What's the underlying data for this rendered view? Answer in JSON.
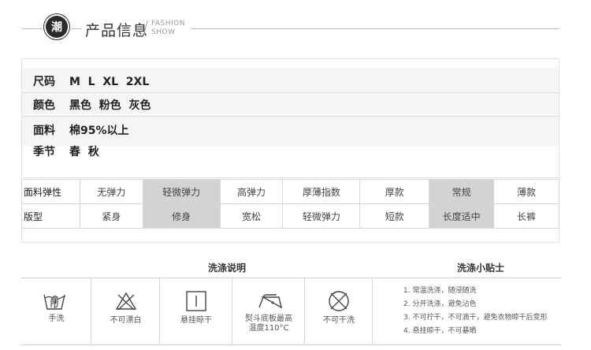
{
  "header": {
    "seal_char": "潮",
    "title": "产品信息",
    "sub_line1": "FASHION",
    "sub_line2": "SHOW"
  },
  "info": [
    {
      "label": "尺码",
      "value": "M  L  XL  2XL"
    },
    {
      "label": "颜色",
      "value": "黑色  粉色  灰色"
    },
    {
      "label": "面料",
      "value": "棉95%以上"
    },
    {
      "label": "季节",
      "value": "春  秋"
    }
  ],
  "properties": [
    {
      "name": "面料弹性",
      "options": [
        "无弹力",
        "轻微弹力",
        "高弹力",
        "厚薄指数",
        "厚款",
        "常规",
        "薄款"
      ],
      "highlight": [
        1,
        5
      ]
    },
    {
      "name": "版型",
      "options": [
        "紧身",
        "修身",
        "宽松",
        "轻微弹力",
        "短款",
        "长度适中",
        "长裤"
      ],
      "highlight": [
        1,
        5
      ]
    }
  ],
  "care": {
    "wash_heading": "洗涤说明",
    "tips_heading": "洗涤小贴士",
    "icons": [
      {
        "icon": "hand-wash-icon",
        "label": "手洗"
      },
      {
        "icon": "no-bleach-icon",
        "label": "不可漂白"
      },
      {
        "icon": "hang-dry-icon",
        "label": "悬挂晾干"
      },
      {
        "icon": "iron-icon",
        "label": "熨斗底板最高\n温度110°C"
      },
      {
        "icon": "no-tumble-dry-icon",
        "label": "不可干洗"
      }
    ],
    "tips": [
      "1. 常温洗涤，随浸随洗",
      "2. 分开洗涤，避免沾色",
      "3. 不可拧干，不可滴干，避免衣物晾干后变形",
      "4. 悬挂晾干，不可暴晒"
    ]
  }
}
